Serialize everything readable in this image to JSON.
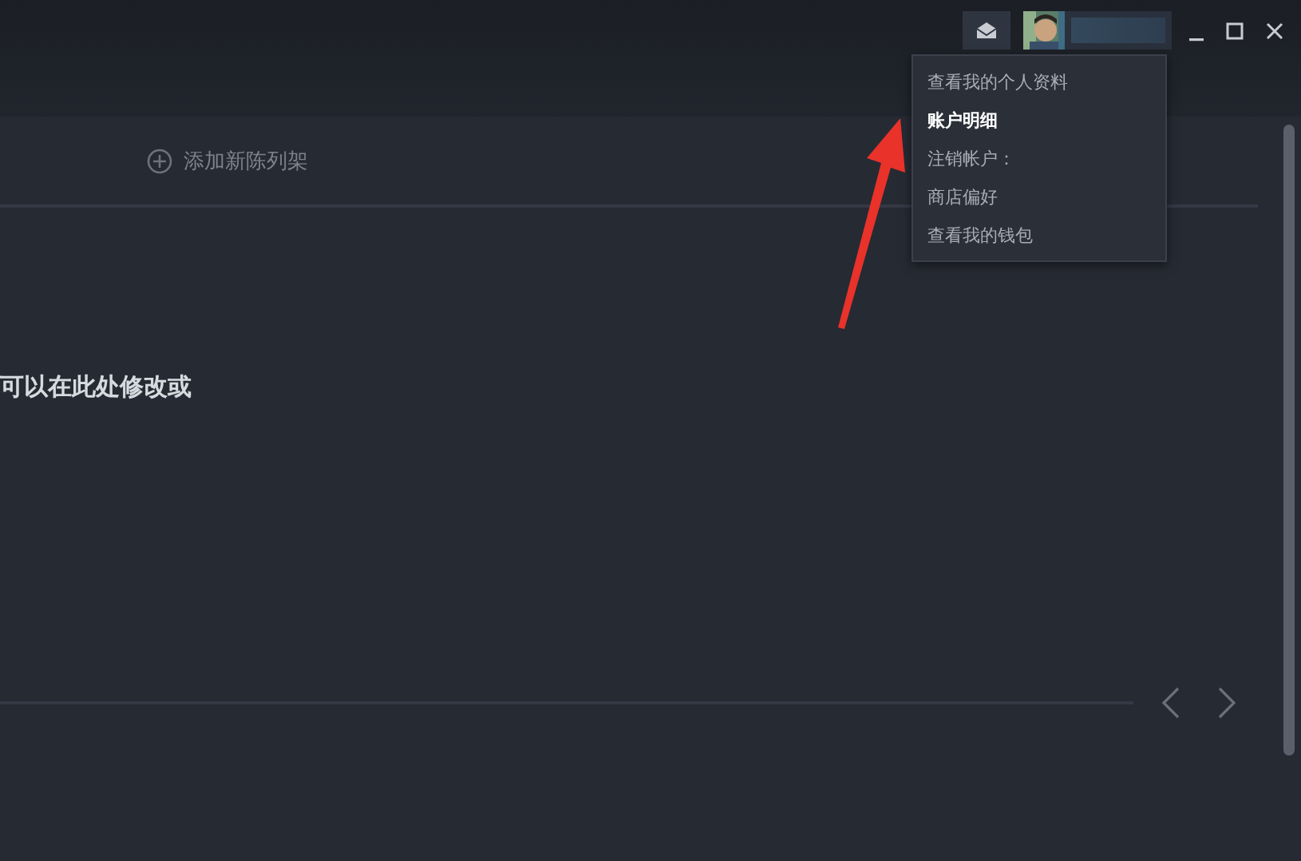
{
  "account_menu": {
    "items": [
      {
        "label": "查看我的个人资料",
        "selected": false
      },
      {
        "label": "账户明细",
        "selected": true
      },
      {
        "label": "注销帐户：",
        "selected": false
      },
      {
        "label": "商店偏好",
        "selected": false
      },
      {
        "label": "查看我的钱包",
        "selected": false
      }
    ]
  },
  "shelf": {
    "add_label": "添加新陈列架"
  },
  "message": "可以在此处修改或"
}
